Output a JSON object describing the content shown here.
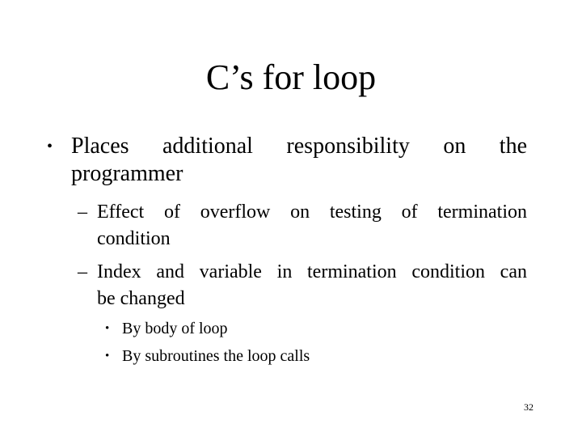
{
  "slide": {
    "title": "C’s for loop",
    "bullets": [
      {
        "marker": "•",
        "line1": "Places additional responsibility on the",
        "line2": "programmer",
        "sub_items": [
          {
            "marker": "–",
            "line1": "Effect of overflow on testing of termination",
            "line2": "condition"
          },
          {
            "marker": "–",
            "line1": "Index and variable in termination condition can",
            "line2": "be changed",
            "sub_items": [
              {
                "marker": "•",
                "text": "By body of loop"
              },
              {
                "marker": "•",
                "text": "By subroutines the loop calls"
              }
            ]
          }
        ]
      }
    ],
    "page_number": "32"
  }
}
